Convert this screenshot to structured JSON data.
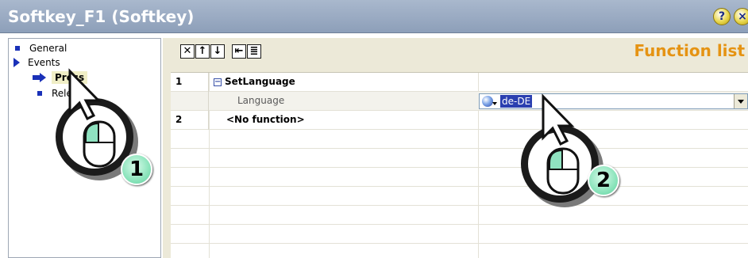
{
  "window": {
    "title": "Softkey_F1 (Softkey)",
    "pin_icon": "pin-icon",
    "close_icon": "close-icon"
  },
  "sidebar": {
    "items": [
      {
        "label": "General",
        "icon": "bullet-icon"
      },
      {
        "label": "Events",
        "icon": "expand-arrow-icon"
      },
      {
        "label": "Press",
        "icon": "selected-arrow-icon",
        "selected": true
      },
      {
        "label": "Release",
        "icon": "bullet-icon"
      }
    ]
  },
  "toolbar": {
    "buttons": [
      {
        "icon": "delete-icon",
        "glyph": "✕"
      },
      {
        "icon": "move-up-icon",
        "glyph": "↑"
      },
      {
        "icon": "move-down-icon",
        "glyph": "↓"
      },
      {
        "icon": "outdent-icon",
        "glyph": "⇤"
      },
      {
        "icon": "list-icon",
        "glyph": "≣"
      }
    ]
  },
  "function_list": {
    "title": "Function list",
    "rows": [
      {
        "number": "1",
        "function": "SetLanguage",
        "expanded": true
      },
      {
        "parameter": "Language",
        "value": "de-DE"
      },
      {
        "number": "2",
        "function": "<No function>"
      }
    ]
  },
  "callouts": [
    {
      "number": "1"
    },
    {
      "number": "2"
    }
  ],
  "colors": {
    "titlebar": "#8d9fb9",
    "accent_title": "#e59313",
    "selection": "#2a3fb0",
    "tree_icon": "#1a31b8",
    "badge": "#7fe0b4"
  }
}
